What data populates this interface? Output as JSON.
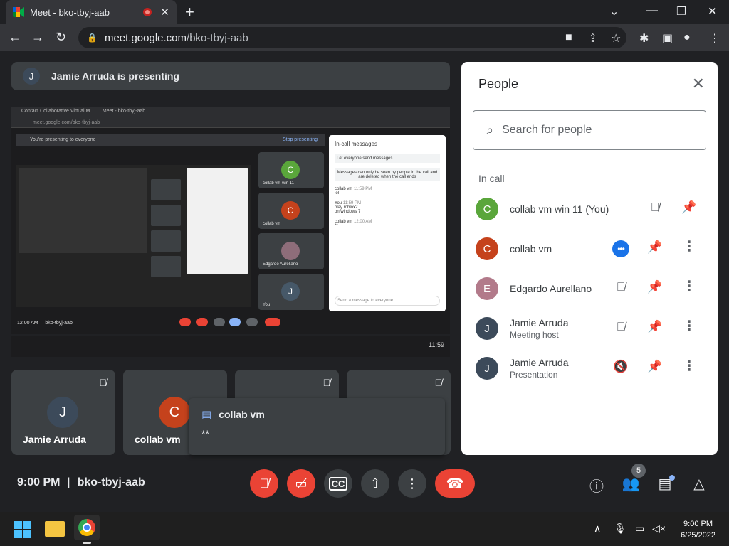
{
  "browser": {
    "tab_title": "Meet - bko-tbyj-aab",
    "url_host": "meet.google.com",
    "url_path": "/bko-tbyj-aab"
  },
  "banner": {
    "avatar_letter": "J",
    "text": "Jamie Arruda is presenting"
  },
  "presented_screen": {
    "tab1": "Contact Collaborative Virtual M...",
    "tab2": "Meet - bko-tbyj-aab",
    "url": "meet.google.com/bko-tbyj-aab",
    "strip_text": "You're presenting to everyone",
    "stop_text": "Stop presenting",
    "panel_title": "In-call messages",
    "panel_toggle": "Let everyone send messages",
    "panel_note": "Messages can only be seen by people in the call and are deleted when the call ends",
    "messages": [
      {
        "sender": "collab vm",
        "time": "11:59 PM",
        "text": "lol"
      },
      {
        "sender": "You",
        "time": "11:59 PM",
        "text": "play roblox?"
      },
      {
        "sender": "",
        "time": "",
        "text": "on windows 7"
      },
      {
        "sender": "collab vm",
        "time": "12:00 AM",
        "text": "**"
      }
    ],
    "panel_input": "Send a message to everyone",
    "tiles": [
      {
        "name": "collab vm win 11",
        "letter": "C",
        "color": "#5aa63b"
      },
      {
        "name": "collab vm",
        "letter": "C",
        "color": "#c5421c"
      },
      {
        "name": "Edgardo Aurellano",
        "letter": "",
        "color": "#8e6d7a"
      },
      {
        "name": "You",
        "letter": "J",
        "color": "#465868"
      }
    ],
    "bottom_time": "12:00 AM",
    "bottom_code": "bko-tbyj-aab",
    "task_time": "11:59"
  },
  "tiles": [
    {
      "name": "Jamie Arruda",
      "letter": "J",
      "color": "#3c4a5a"
    },
    {
      "name": "collab vm",
      "letter": "C",
      "color": "#c5421c"
    },
    {
      "name": "",
      "letter": "",
      "color": "#c5421c"
    },
    {
      "name": "",
      "letter": "",
      "color": "#5aa63b"
    }
  ],
  "chat_popup": {
    "sender": "collab vm",
    "message": "**"
  },
  "people_panel": {
    "title": "People",
    "search_placeholder": "Search for people",
    "section_label": "In call",
    "participants": [
      {
        "name": "collab vm win 11 (You)",
        "sub": "",
        "letter": "C",
        "color": "#5aa63b"
      },
      {
        "name": "collab vm",
        "sub": "",
        "letter": "C",
        "color": "#c5421c"
      },
      {
        "name": "Edgardo Aurellano",
        "sub": "",
        "letter": "E",
        "color": "#b27a8a"
      },
      {
        "name": "Jamie Arruda",
        "sub": "Meeting host",
        "letter": "J",
        "color": "#3c4a5a"
      },
      {
        "name": "Jamie Arruda",
        "sub": "Presentation",
        "letter": "J",
        "color": "#3c4a5a"
      }
    ]
  },
  "control_bar": {
    "time": "9:00 PM",
    "meeting_code": "bko-tbyj-aab",
    "people_count": "5"
  },
  "taskbar": {
    "time": "9:00 PM",
    "date": "6/25/2022"
  },
  "colors": {
    "accent_red": "#ea4335",
    "panel_blue": "#1a73e8",
    "background": "#202124"
  }
}
